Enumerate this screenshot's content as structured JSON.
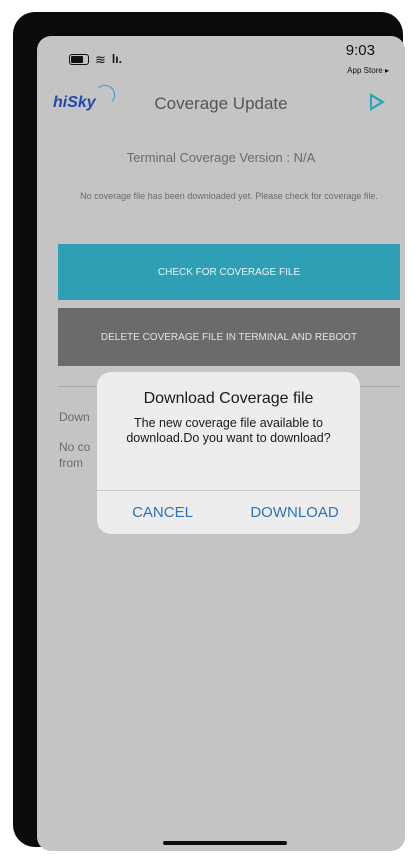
{
  "status_bar": {
    "signal_text": "lı.",
    "time": "9:03",
    "back_app": "App Store ▸"
  },
  "header": {
    "logo_text": "hiSky",
    "title": "Coverage Update"
  },
  "content": {
    "version_label": "Terminal Coverage Version : N/A",
    "notice": "No coverage file has been downloaded yet. Please check for coverage file.",
    "check_button": "CHECK FOR COVERAGE FILE",
    "delete_button": "DELETE COVERAGE FILE IN TERMINAL AND REBOOT",
    "download_heading_partial": "Down",
    "line1_partial": "No co",
    "line2_partial": "from"
  },
  "dialog": {
    "title": "Download Coverage file",
    "message": "The new coverage file available to download.Do you want to download?",
    "cancel_label": "CANCEL",
    "download_label": "DOWNLOAD"
  },
  "colors": {
    "accent": "#2e9fb5",
    "delete_button_bg": "#6b6b6b",
    "dialog_action": "#2d73b8",
    "logo": "#1f4aa8"
  },
  "icons": {
    "battery": "battery-icon",
    "wifi": "wifi-icon",
    "play": "play-icon"
  }
}
